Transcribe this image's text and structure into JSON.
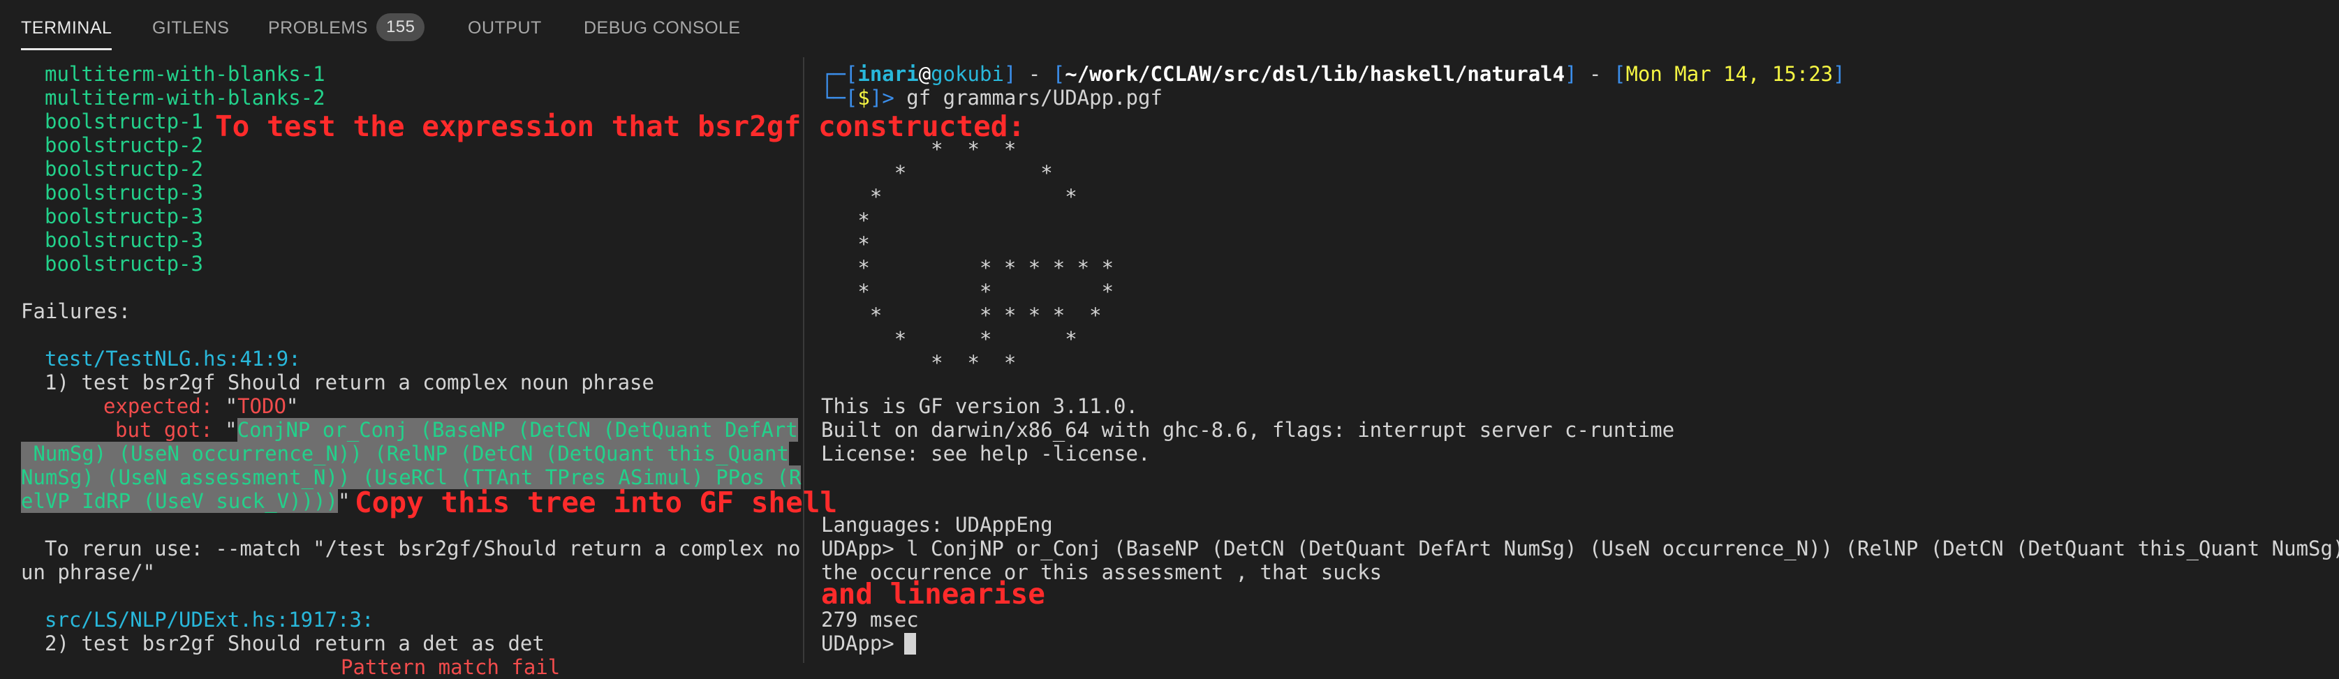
{
  "tabs": [
    {
      "label": "TERMINAL"
    },
    {
      "label": "GITLENS"
    },
    {
      "label": "PROBLEMS",
      "badge": "155"
    },
    {
      "label": "OUTPUT"
    },
    {
      "label": "DEBUG CONSOLE"
    }
  ],
  "left": {
    "tests": [
      "multiterm-with-blanks-1",
      "multiterm-with-blanks-2",
      "boolstructp-1",
      "boolstructp-2",
      "boolstructp-2",
      "boolstructp-3",
      "boolstructp-3",
      "boolstructp-3",
      "boolstructp-3"
    ],
    "failures_heading": "Failures:",
    "f1_location": "test/TestNLG.hs:41:9:",
    "f1_title": "1) test bsr2gf Should return a complex noun phrase",
    "expected_label": "expected: ",
    "expected_quote_open": "\"",
    "expected_value": "TODO",
    "expected_quote_close": "\"",
    "butgot_label": "but got: ",
    "butgot_quote": "\"",
    "got_lines": [
      "ConjNP or_Conj (BaseNP (DetCN (DetQuant DefArt",
      " NumSg) (UseN occurrence_N)) (RelNP (DetCN (DetQuant this_Quant",
      "NumSg) (UseN assessment_N)) (UseRCl (TTAnt TPres ASimul) PPos (R",
      "elVP IdRP (UseV suck_V))))"
    ],
    "got_quote_close": "\"",
    "rerun_1": "To rerun use: --match \"/test bsr2gf/Should return a complex no",
    "rerun_2": "un phrase/\"",
    "f2_location": "src/LS/NLP/UDExt.hs:1917:3:",
    "f2_title": "2) test bsr2gf Should return a det as det",
    "f2_partial": "Pattern match fail"
  },
  "right": {
    "prompt_user": "inari",
    "prompt_at": "@",
    "prompt_host": "gokubi",
    "prompt_dash": " - ",
    "prompt_path": "~/work/CCLAW/src/dsl/lib/haskell/natural4",
    "prompt_date": "Mon Mar 14, 15:23",
    "prompt_dollar": "$",
    "command": "gf grammars/UDApp.pgf",
    "logo": [
      "         *  *  *",
      "      *           *",
      "    *               *",
      "   *",
      "   *",
      "   *         * * * * * *",
      "   *         *         *",
      "    *        * * * *  *",
      "      *      *      *",
      "         *  *  *"
    ],
    "version": "This is GF version 3.11.0.",
    "built": "Built on darwin/x86_64 with ghc-8.6, flags: interrupt server c-runtime",
    "license": "License: see help -license.",
    "languages": "Languages: UDAppEng",
    "linearise_cmd": "UDApp> l ConjNP or_Conj (BaseNP (DetCN (DetQuant DefArt NumSg) (UseN occurrence_N)) (RelNP (DetCN (DetQuant this_Quant NumSg) (U",
    "output": "the occurrence or this assessment , that sucks",
    "timing": "279 msec",
    "final_prompt": "UDApp> "
  },
  "annotations": {
    "test_expr": "To test the expression that bsr2gf constructed:",
    "copy_tree": "Copy this tree into GF shell",
    "linearise": "and linearise"
  }
}
